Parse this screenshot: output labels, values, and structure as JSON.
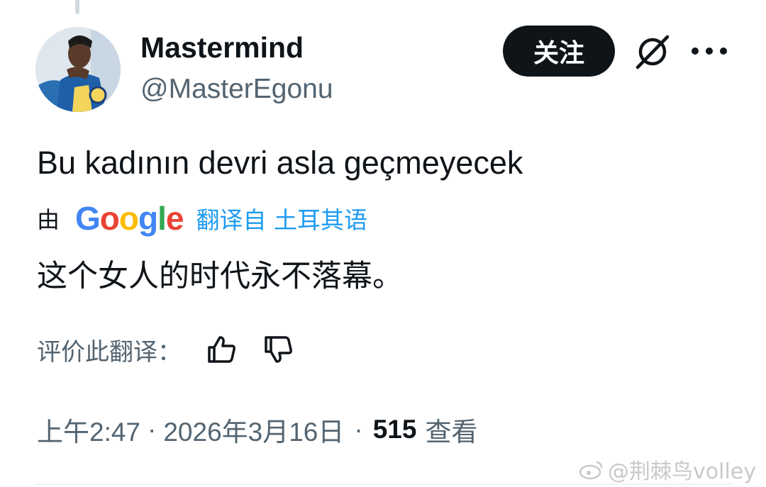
{
  "user": {
    "display_name": "Mastermind",
    "handle": "@MasterEgonu"
  },
  "actions": {
    "follow_label": "关注",
    "grok_icon": "slash-circle-icon",
    "more_icon": "more-dots-icon"
  },
  "tweet": {
    "text": "Bu kadının devri asla geçmeyecek",
    "translated_by_prefix": "由",
    "google_logo": "Google",
    "translated_from_label": "翻译自 土耳其语",
    "translation": "这个女人的时代永不落幕。",
    "rate_label": "评价此翻译："
  },
  "meta": {
    "time": "上午2:47",
    "date": "2026年3月16日",
    "views_count": "515",
    "views_label": "查看",
    "separator": "·"
  },
  "watermark": {
    "text": "@荆棘鸟volley"
  },
  "colors": {
    "text_primary": "#0f1419",
    "text_secondary": "#536471",
    "link_blue": "#1d9bf0",
    "google_blue": "#4285F4",
    "google_red": "#EA4335",
    "google_yellow": "#FBBC05",
    "google_green": "#34A853"
  }
}
